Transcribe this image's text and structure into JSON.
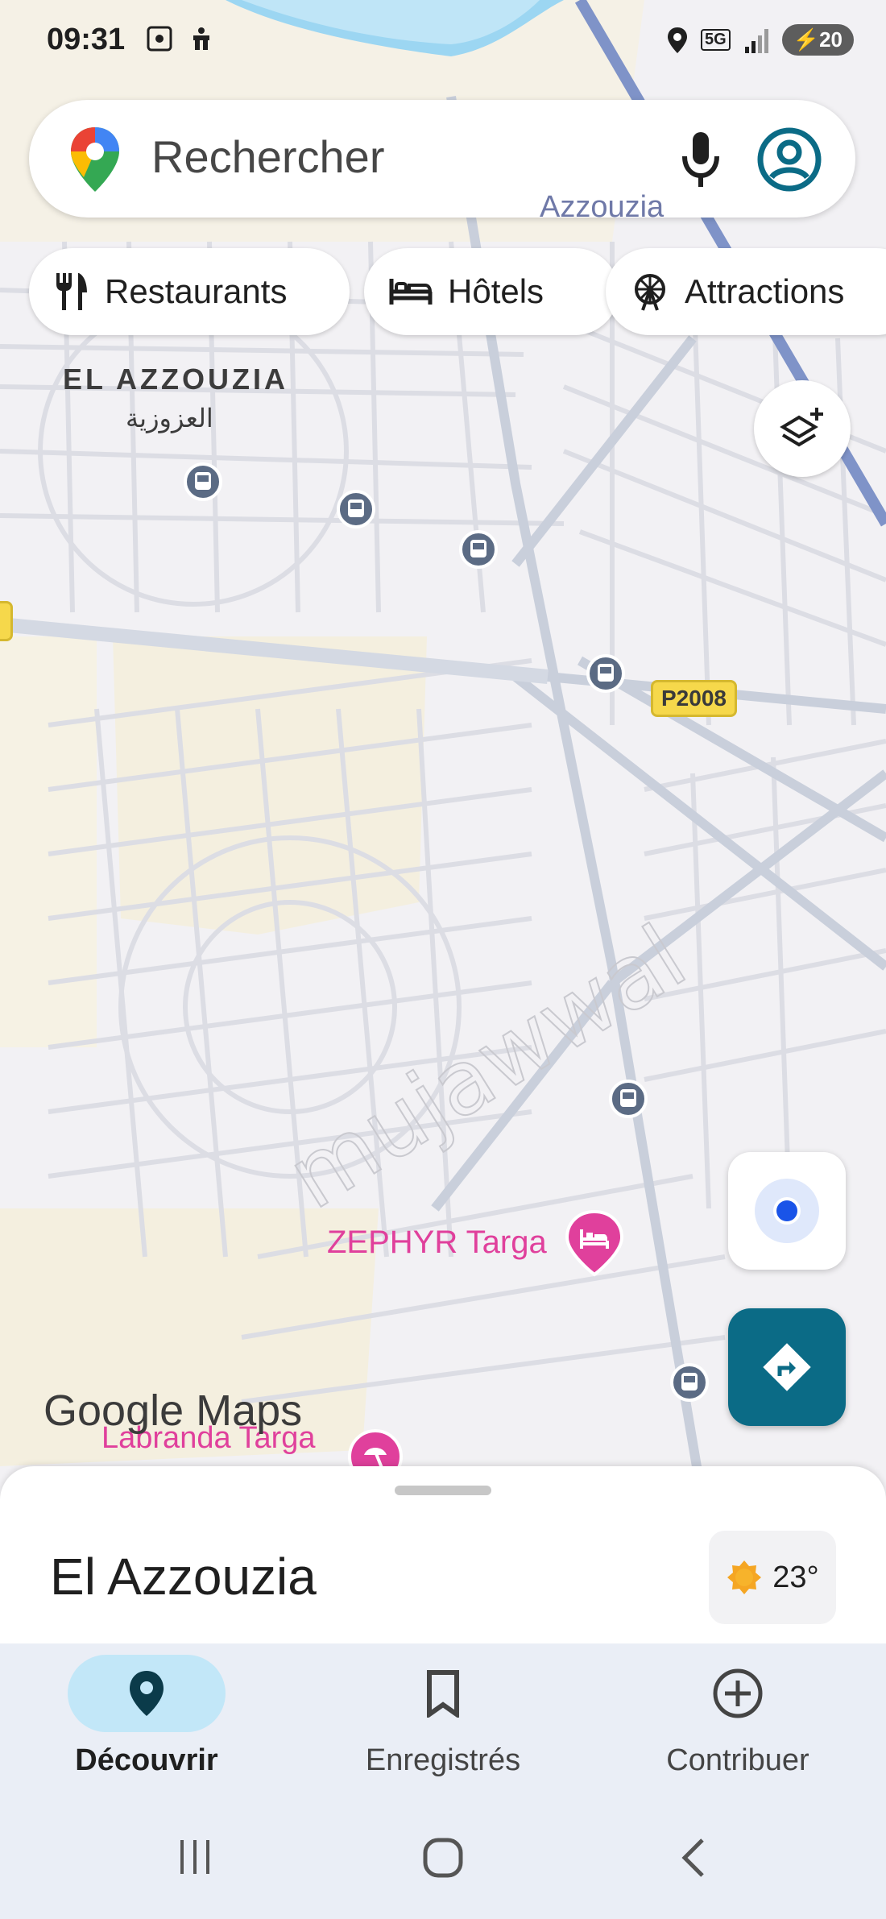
{
  "status_bar": {
    "time": "09:31",
    "network": "5G",
    "battery": "20"
  },
  "search": {
    "placeholder": "Rechercher"
  },
  "chips": [
    {
      "label": "Restaurants",
      "icon": "fork-knife-icon"
    },
    {
      "label": "Hôtels",
      "icon": "bed-icon"
    },
    {
      "label": "Attractions",
      "icon": "ferris-wheel-icon"
    }
  ],
  "map": {
    "area_label": "EL AZZOUZIA",
    "area_label_ar": "العزوزية",
    "top_label_partial": "Azzouzia",
    "road_badge": "P2008",
    "poi_zephyr": "ZEPHYR Targa",
    "poi_labranda": "Labranda Targa",
    "watermark": "mujawwal"
  },
  "branding": {
    "logo": "Google Maps"
  },
  "sheet": {
    "place_name": "El Azzouzia",
    "temperature": "23°"
  },
  "bottom_nav": [
    {
      "label": "Découvrir",
      "icon": "location-pin-icon",
      "active": true
    },
    {
      "label": "Enregistrés",
      "icon": "bookmark-icon",
      "active": false
    },
    {
      "label": "Contribuer",
      "icon": "add-circle-icon",
      "active": false
    }
  ],
  "colors": {
    "accent": "#0b6b86",
    "poi_pink": "#e0409c",
    "road_badge_bg": "#f6d84b",
    "nav_active_bg": "#c2e7f8"
  }
}
